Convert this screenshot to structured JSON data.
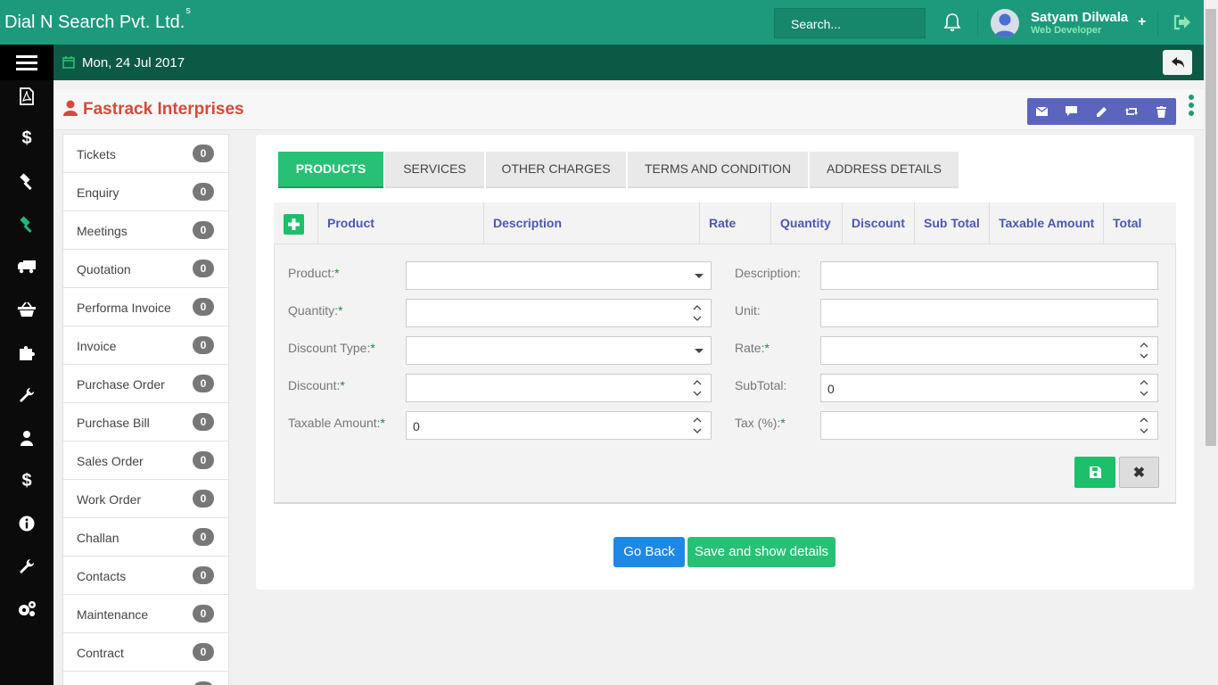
{
  "header": {
    "brand": "Dial N Search Pvt. Ltd.",
    "brand_sup": "s",
    "search_placeholder": "Search...",
    "user_name": "Satyam Dilwala",
    "user_role": "Web Developer",
    "plus": "+"
  },
  "subbar": {
    "date": "Mon, 24 Jul 2017"
  },
  "iconbar": {
    "icons": [
      "pdf-icon",
      "dollar-icon",
      "gavel-icon",
      "gavel-icon-active",
      "truck-icon",
      "basket-icon",
      "puzzle-icon",
      "wrench-icon",
      "user-icon",
      "dollar-icon",
      "info-icon",
      "wrench-icon",
      "gears-icon"
    ],
    "dollar": "$",
    "info": "i"
  },
  "page": {
    "company": "Fastrack Interprises"
  },
  "modules": [
    {
      "label": "Tickets",
      "count": "0"
    },
    {
      "label": "Enquiry",
      "count": "0"
    },
    {
      "label": "Meetings",
      "count": "0"
    },
    {
      "label": "Quotation",
      "count": "0"
    },
    {
      "label": "Performa Invoice",
      "count": "0"
    },
    {
      "label": "Invoice",
      "count": "0"
    },
    {
      "label": "Purchase Order",
      "count": "0"
    },
    {
      "label": "Purchase Bill",
      "count": "0"
    },
    {
      "label": "Sales Order",
      "count": "0"
    },
    {
      "label": "Work Order",
      "count": "0"
    },
    {
      "label": "Challan",
      "count": "0"
    },
    {
      "label": "Contacts",
      "count": "0"
    },
    {
      "label": "Maintenance",
      "count": "0"
    },
    {
      "label": "Contract",
      "count": "0"
    }
  ],
  "tabs": [
    {
      "label": "PRODUCTS",
      "active": true
    },
    {
      "label": "SERVICES"
    },
    {
      "label": "OTHER CHARGES"
    },
    {
      "label": "TERMS AND CONDITION"
    },
    {
      "label": "ADDRESS DETAILS"
    }
  ],
  "grid": {
    "columns": [
      "Product",
      "Description",
      "Rate",
      "Quantity",
      "Discount",
      "Sub Total",
      "Taxable Amount",
      "Total"
    ]
  },
  "form": {
    "product_label": "Product:",
    "description_label": "Description:",
    "quantity_label": "Quantity:",
    "unit_label": "Unit:",
    "discount_type_label": "Discount Type:",
    "rate_label": "Rate:",
    "discount_label": "Discount:",
    "subtotal_label": "SubTotal:",
    "subtotal_value": "0",
    "taxable_label": "Taxable Amount:",
    "taxable_value": "0",
    "tax_label": "Tax (%):",
    "required_mark": "*"
  },
  "buttons": {
    "go_back": "Go Back",
    "save_details": "Save and show details",
    "close": "✖"
  },
  "colors": {
    "header": "#1d9a7b",
    "subbar": "#0c5a46",
    "accent_green": "#27c175",
    "primary_blue": "#1e88e5",
    "action_purple": "#5b65bd",
    "title_red": "#d34a3d"
  }
}
